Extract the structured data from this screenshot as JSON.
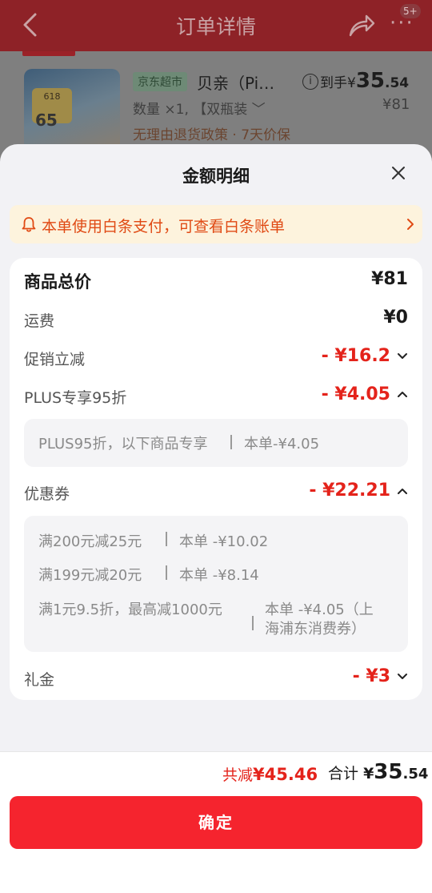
{
  "background_page": {
    "title": "订单详情",
    "badge": "5+",
    "product": {
      "image_badge": "618",
      "image_number": "65",
      "store_tag": "京东超市",
      "name": "贝亲（Pi…",
      "price_prefix": "到手¥",
      "price_int": "35",
      "price_dec": ".54",
      "quantity_spec": "数量 ×1, 【双瓶装 ﹀",
      "original_price": "¥81",
      "policy": "无理由退货政策 · 7天价保"
    }
  },
  "sheet": {
    "title": "金额明细",
    "notice": "本单使用白条支付，可查看白条账单",
    "rows": {
      "goods_total": {
        "label": "商品总价",
        "value": "¥81"
      },
      "shipping": {
        "label": "运费",
        "value": "¥0"
      },
      "promotion": {
        "label": "促销立减",
        "value": "- ¥16.2"
      },
      "plus": {
        "label": "PLUS专享95折",
        "value": "- ¥4.05"
      },
      "coupon": {
        "label": "优惠券",
        "value": "- ¥22.21"
      },
      "gift": {
        "label": "礼金",
        "value": "- ¥3"
      }
    },
    "plus_detail": {
      "desc": "PLUS95折，以下商品专享",
      "amount": "本单-¥4.05"
    },
    "coupon_details": [
      {
        "desc": "满200元减25元",
        "amount": "本单 -¥10.02"
      },
      {
        "desc": "满199元减20元",
        "amount": "本单 -¥8.14"
      },
      {
        "desc": "满1元9.5折，最高减1000元",
        "amount_line1": "本单 -¥4.05（上",
        "amount_line2": "海浦东消费券）"
      }
    ]
  },
  "footer": {
    "saved_label": "共减",
    "saved_amount": "¥45.46",
    "total_label": "合计",
    "total_currency": "¥",
    "total_int": "35",
    "total_dec": ".54",
    "confirm_label": "确定"
  },
  "colors": {
    "accent_red": "#f5242e",
    "price_red": "#e4231b",
    "notice_bg": "#fdf3dd",
    "notice_text": "#e04a14"
  }
}
